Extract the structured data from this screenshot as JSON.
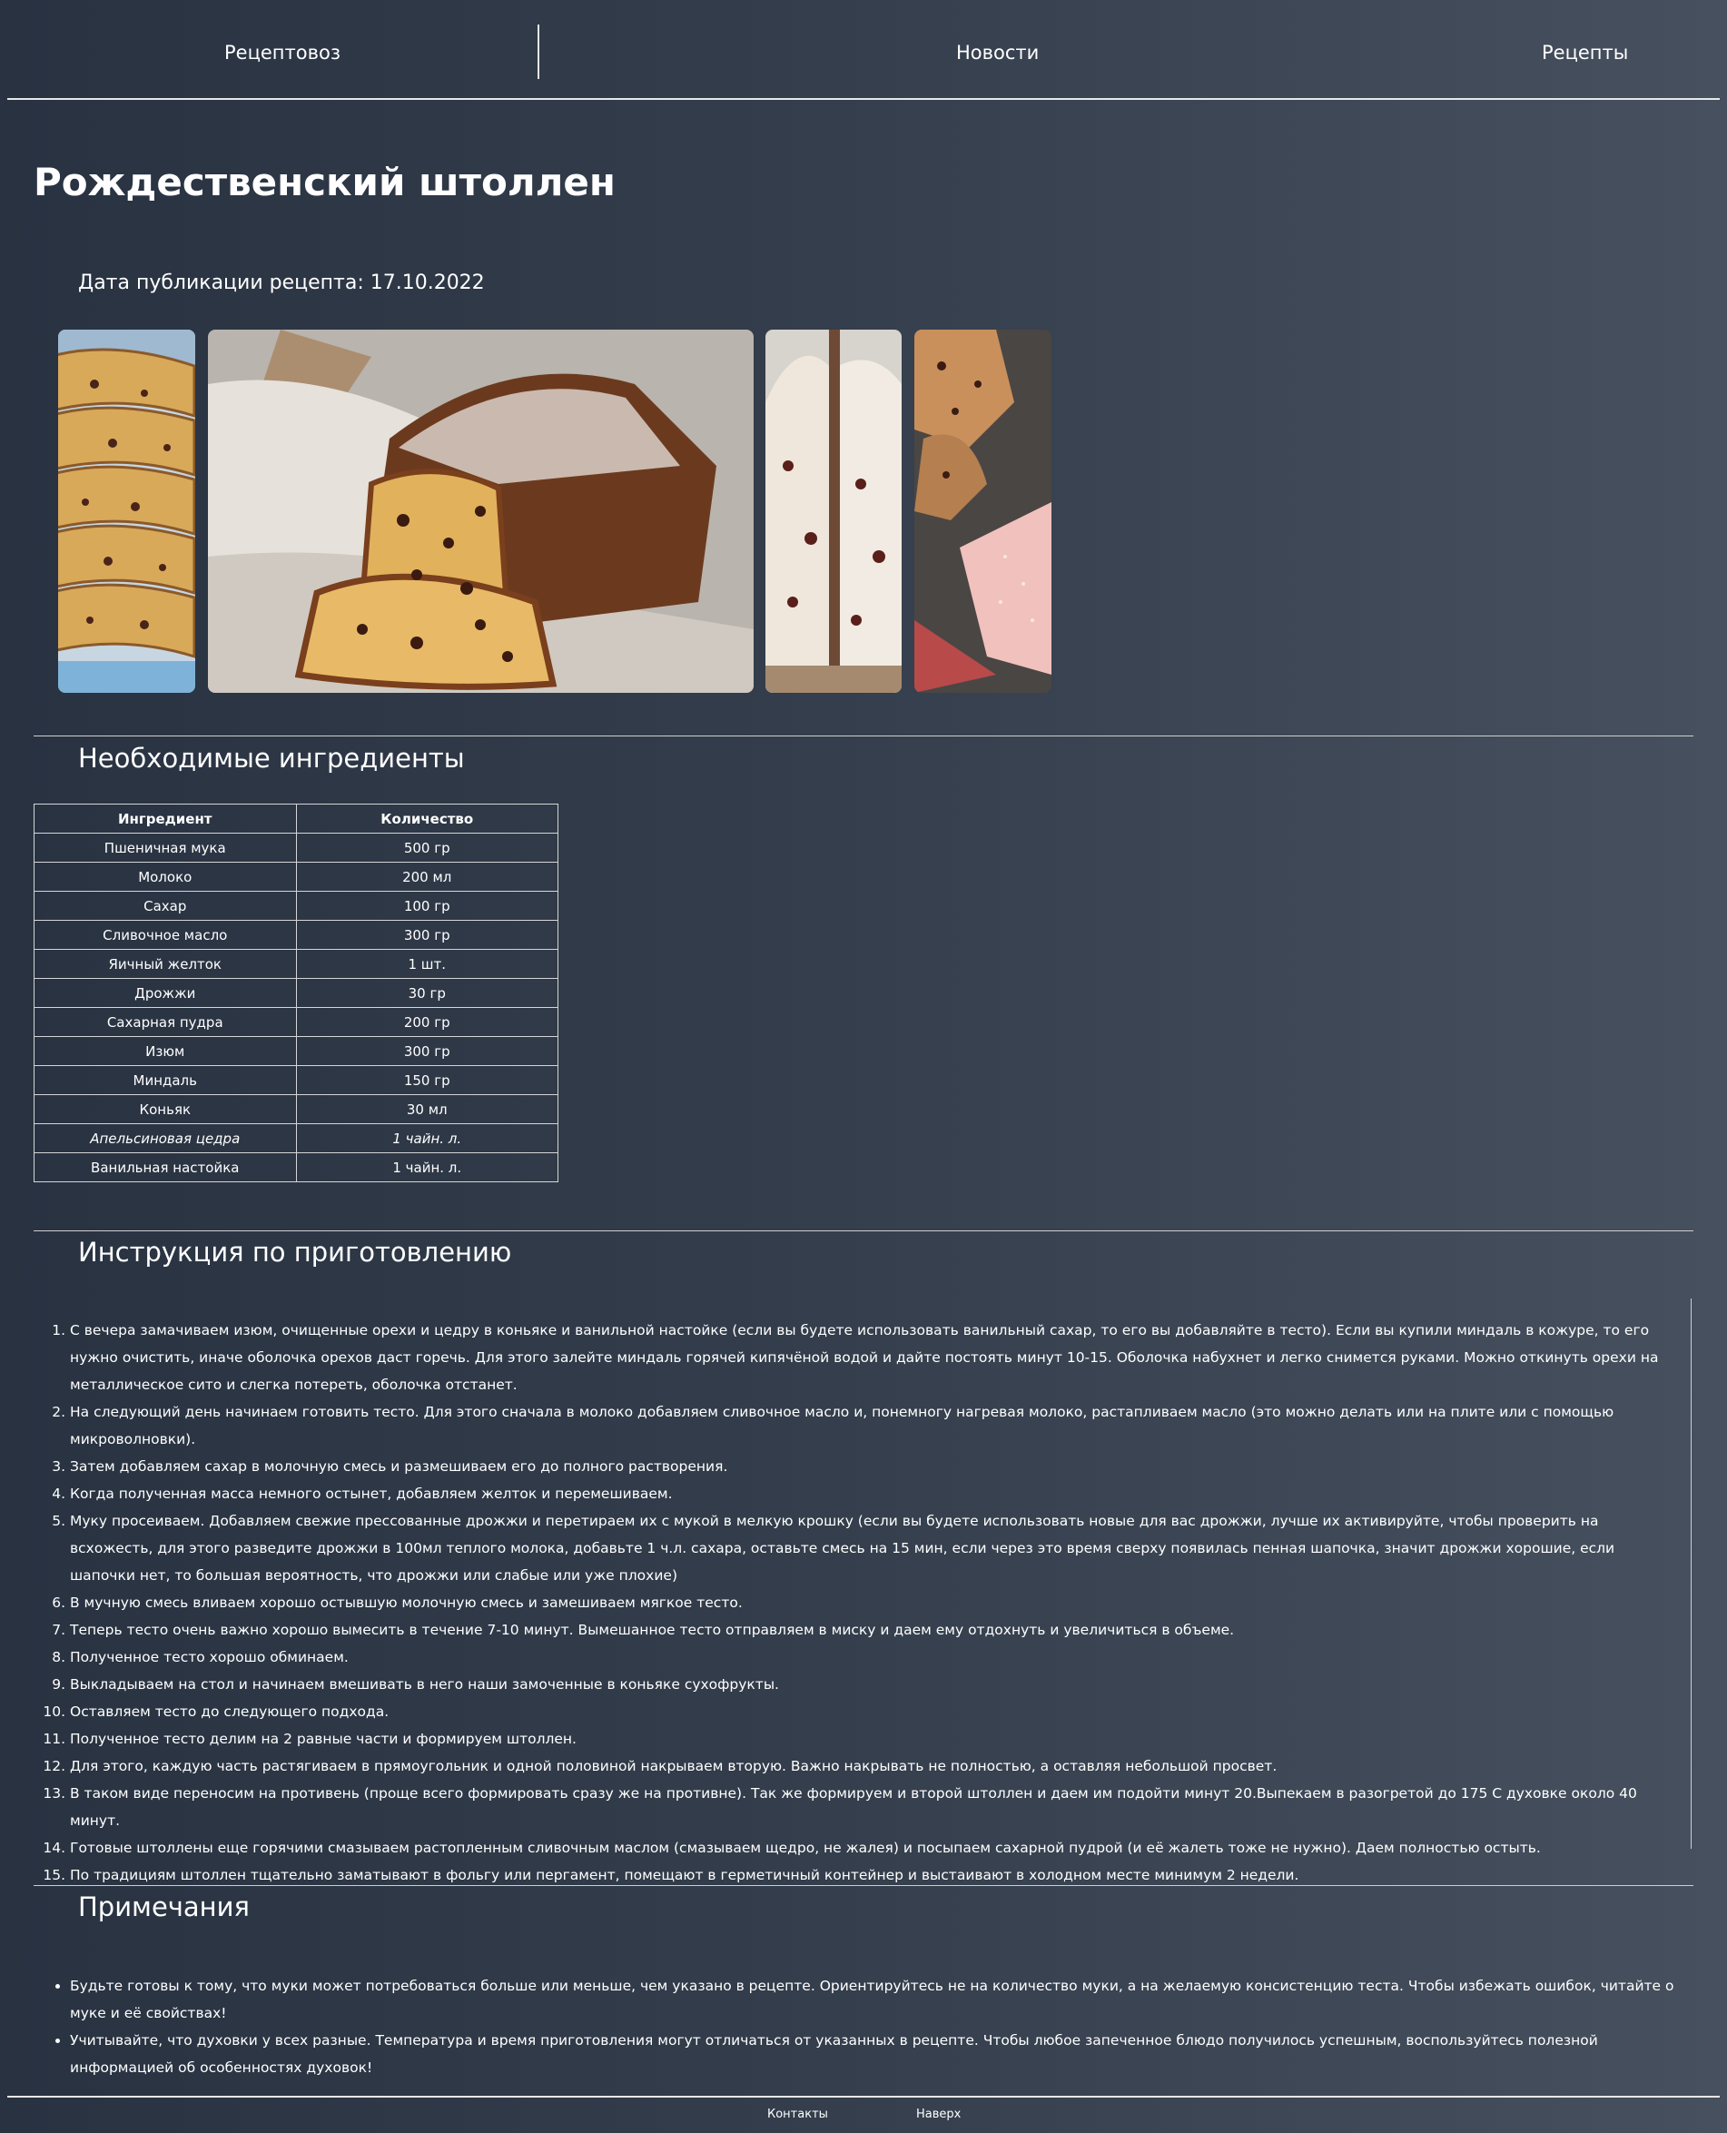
{
  "nav": {
    "brand": "Рецептовоз",
    "news": "Новости",
    "recipes": "Рецепты"
  },
  "recipe": {
    "title": "Рождественский штоллен",
    "published": "Дата публикации рецепта: 17.10.2022"
  },
  "ingredients": {
    "heading": "Необходимые ингредиенты",
    "columns": [
      "Ингредиент",
      "Количество"
    ],
    "rows": [
      [
        "Пшеничная мука",
        "500 гр"
      ],
      [
        "Молоко",
        "200 мл"
      ],
      [
        "Сахар",
        "100 гр"
      ],
      [
        "Сливочное масло",
        "300 гр"
      ],
      [
        "Яичный желток",
        "1 шт."
      ],
      [
        "Дрожжи",
        "30 гр"
      ],
      [
        "Сахарная пудра",
        "200 гр"
      ],
      [
        "Изюм",
        "300 гр"
      ],
      [
        "Миндаль",
        "150 гр"
      ],
      [
        "Коньяк",
        "30 мл"
      ],
      [
        "Апельсиновая цедра",
        "1 чайн. л."
      ],
      [
        "Ванильная настойка",
        "1 чайн. л."
      ]
    ]
  },
  "instructions": {
    "heading": "Инструкция по приготовлению",
    "steps": [
      "С вечера замачиваем изюм, очищенные орехи и цедру в коньяке и ванильной настойке (если вы будете использовать ванильный сахар, то его вы добавляйте в тесто). Если вы купили миндаль в кожуре, то его нужно очистить, иначе оболочка орехов даст горечь. Для этого залейте миндаль горячей кипячёной водой и дайте постоять минут 10-15. Оболочка набухнет и легко снимется руками. Можно откинуть орехи на металлическое сито и слегка потереть, оболочка отстанет.",
      "На следующий день начинаем готовить тесто. Для этого сначала в молоко добавляем сливочное масло и, понемногу нагревая молоко, растапливаем масло (это можно делать или на плите или с помощью микроволновки).",
      "Затем добавляем сахар в молочную смесь и размешиваем его до полного растворения.",
      "Когда полученная масса немного остынет, добавляем желток и перемешиваем.",
      "Муку просеиваем. Добавляем свежие прессованные дрожжи и перетираем их с мукой в мелкую крошку (если вы будете использовать новые для вас дрожжи, лучше их активируйте, чтобы проверить на всхожесть, для этого разведите дрожжи в 100мл теплого молока, добавьте 1 ч.л. сахара, оставьте смесь на 15 мин, если через это время сверху появилась пенная шапочка, значит дрожжи хорошие, если шапочки нет, то большая вероятность, что дрожжи или слабые или уже плохие)",
      "В мучную смесь вливаем хорошо остывшую молочную смесь и замешиваем мягкое тесто.",
      "Теперь тесто очень важно хорошо вымесить в течение 7-10 минут. Вымешанное тесто отправляем в миску и даем ему отдохнуть и увеличиться в объеме.",
      "Полученное тесто хорошо обминаем.",
      "Выкладываем на стол и начинаем вмешивать в него наши замоченные в коньяке сухофрукты.",
      "Оставляем тесто до следующего подхода.",
      "Полученное тесто делим на 2 равные части и формируем штоллен.",
      "Для этого, каждую часть растягиваем в прямоугольник и одной половиной накрываем вторую. Важно накрывать не полностью, а оставляя небольшой просвет.",
      "В таком виде переносим на противень (проще всего формировать сразу же на противне). Так же формируем и второй штоллен и даем им подойти минут 20.Выпекаем в разогретой до 175 С духовке около 40 минут.",
      "Готовые штоллены еще горячими смазываем растопленным сливочным маслом (смазываем щедро, не жалея) и посыпаем сахарной пудрой (и её жалеть тоже не нужно). Даем полностью остыть.",
      "По традициям штоллен тщательно заматывают в фольгу или пергамент, помещают в герметичный контейнер и выстаивают в холодном месте минимум 2 недели."
    ]
  },
  "notes": {
    "heading": "Примечания",
    "items": [
      "Будьте готовы к тому, что муки может потребоваться больше или меньше, чем указано в рецепте. Ориентируйтесь не на количество муки, а на желаемую консистенцию теста. Чтобы избежать ошибок, читайте о муке и её свойствах!",
      "Учитывайте, что духовки у всех разные. Температура и время приготовления могут отличаться от указанных в рецепте. Чтобы любое запеченное блюдо получилось успешным, воспользуйтесь полезной информацией об особенностях духовок!"
    ]
  },
  "footer": {
    "contacts": "Контакты",
    "top": "Наверх"
  },
  "colors": {
    "background_left": "#283241",
    "background_right": "#46505e",
    "text": "#ffffff",
    "rule": "#e8e8e8"
  }
}
